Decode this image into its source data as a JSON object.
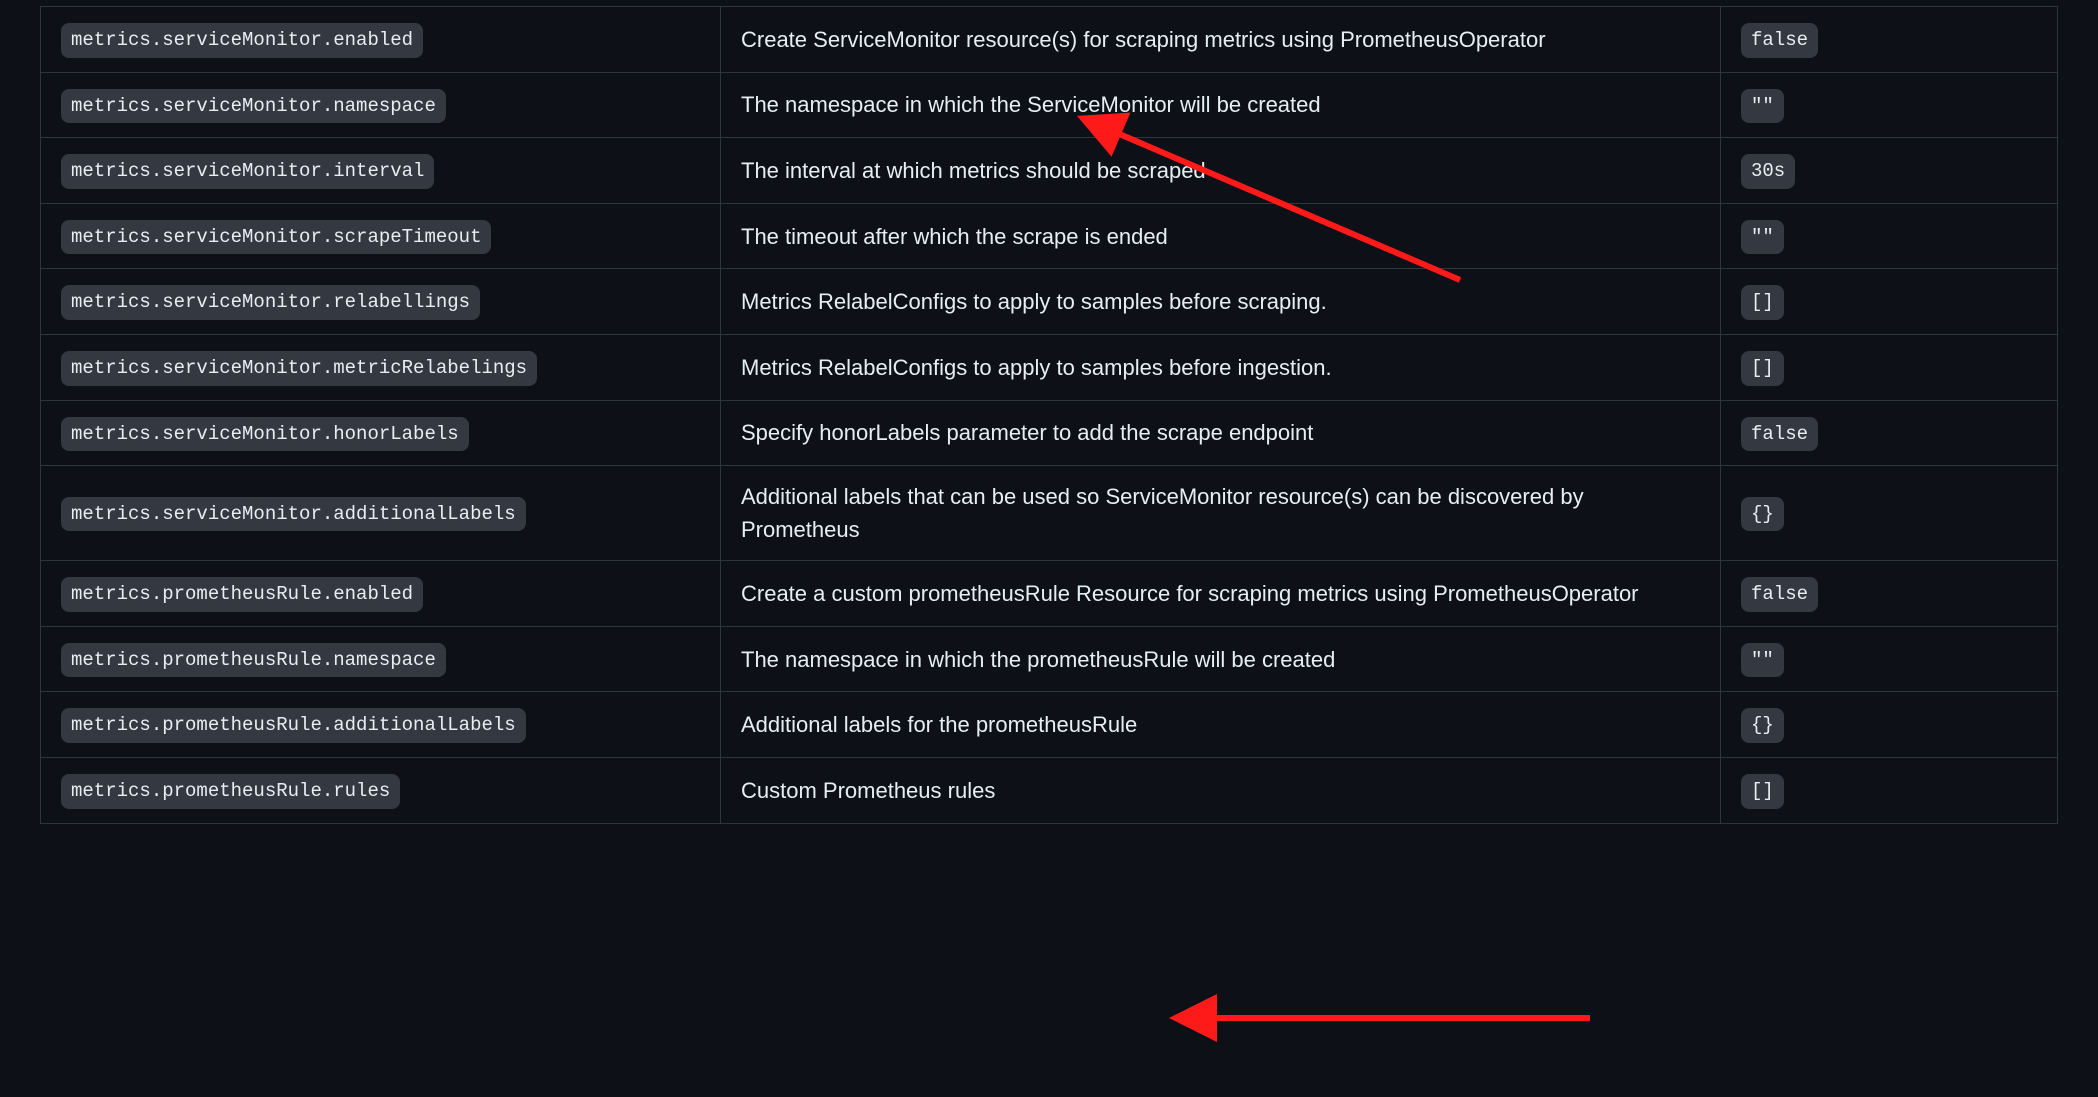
{
  "rows": [
    {
      "param": "metrics.serviceMonitor.enabled",
      "desc": "Create ServiceMonitor resource(s) for scraping metrics using PrometheusOperator",
      "val": "false"
    },
    {
      "param": "metrics.serviceMonitor.namespace",
      "desc": "The namespace in which the ServiceMonitor will be created",
      "val": "\"\""
    },
    {
      "param": "metrics.serviceMonitor.interval",
      "desc": "The interval at which metrics should be scraped",
      "val": "30s"
    },
    {
      "param": "metrics.serviceMonitor.scrapeTimeout",
      "desc": "The timeout after which the scrape is ended",
      "val": "\"\""
    },
    {
      "param": "metrics.serviceMonitor.relabellings",
      "desc": "Metrics RelabelConfigs to apply to samples before scraping.",
      "val": "[]"
    },
    {
      "param": "metrics.serviceMonitor.metricRelabelings",
      "desc": "Metrics RelabelConfigs to apply to samples before ingestion.",
      "val": "[]"
    },
    {
      "param": "metrics.serviceMonitor.honorLabels",
      "desc": "Specify honorLabels parameter to add the scrape endpoint",
      "val": "false"
    },
    {
      "param": "metrics.serviceMonitor.additionalLabels",
      "desc": "Additional labels that can be used so ServiceMonitor resource(s) can be discovered by Prometheus",
      "val": "{}"
    },
    {
      "param": "metrics.prometheusRule.enabled",
      "desc": "Create a custom prometheusRule Resource for scraping metrics using PrometheusOperator",
      "val": "false"
    },
    {
      "param": "metrics.prometheusRule.namespace",
      "desc": "The namespace in which the prometheusRule will be created",
      "val": "\"\""
    },
    {
      "param": "metrics.prometheusRule.additionalLabels",
      "desc": "Additional labels for the prometheusRule",
      "val": "{}"
    },
    {
      "param": "metrics.prometheusRule.rules",
      "desc": "Custom Prometheus rules",
      "val": "[]"
    }
  ],
  "annotations": {
    "color": "#ff1a1a"
  }
}
